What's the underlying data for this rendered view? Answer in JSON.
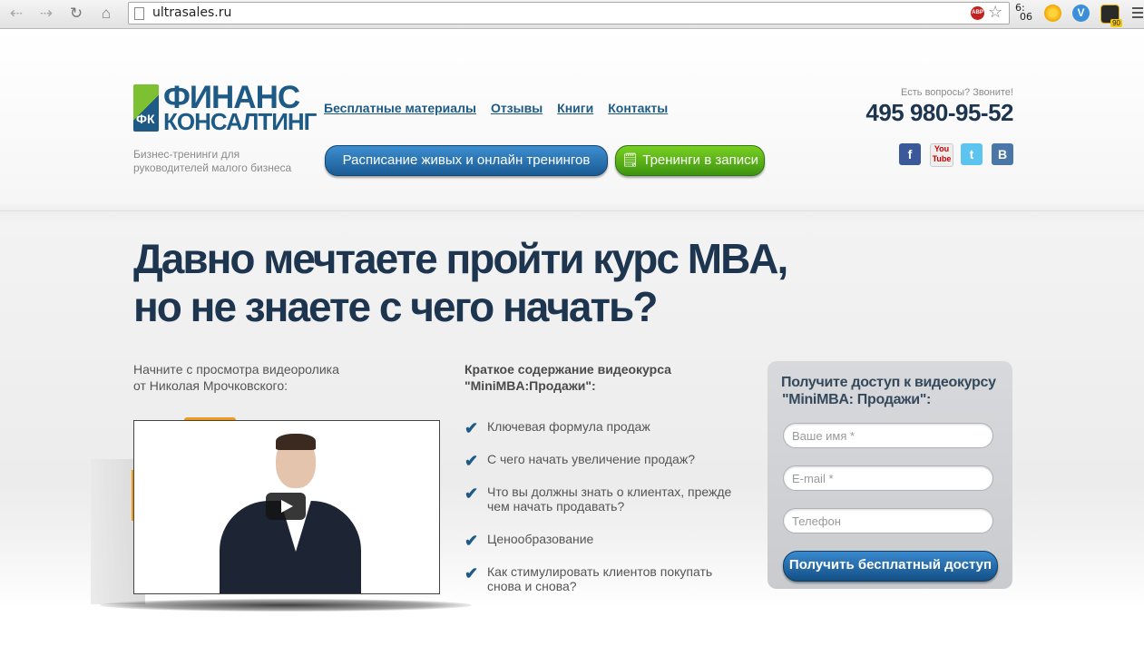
{
  "browser": {
    "url": "ultrasales.ru",
    "clock": [
      "6:",
      "06"
    ],
    "ext_badge": "90",
    "abp_label": "ABP"
  },
  "logo": {
    "line1": "ФИНАНС",
    "line2": "КОНСАЛТИНГ",
    "mark": "ФК"
  },
  "tagline": "Бизнес-тренинги для руководителей малого бизнеса",
  "nav": [
    "Бесплатные материалы",
    "Отзывы",
    "Книги",
    "Контакты"
  ],
  "buttons": {
    "schedule": "Расписание живых и онлайн тренингов",
    "recorded": "Тренинги в записи"
  },
  "contact": {
    "question": "Есть вопросы? Звоните!",
    "phone": "495 980-95-52"
  },
  "social": [
    "facebook",
    "youtube",
    "twitter",
    "vkontakte"
  ],
  "headline": [
    "Давно мечтаете пройти курс MBA,",
    "но не знаете с чего начать?"
  ],
  "intro": [
    "Начните с просмотра видеоролика",
    "от Николая Мрочковского:"
  ],
  "course": {
    "title": [
      "Краткое содержание видеокурса",
      "\"MiniMBA:Продажи\":"
    ],
    "items": [
      "Ключевая формула продаж",
      "С чего начать увеличение продаж?",
      "Что вы должны знать о клиентах, прежде чем начать продавать?",
      "Ценообразование",
      "Как стимулировать клиентов покупать снова и снова?"
    ]
  },
  "form": {
    "title": [
      "Получите доступ к видеокурсу",
      "\"MiniMBA: Продажи\":"
    ],
    "name_placeholder": "Ваше имя *",
    "email_placeholder": "E-mail *",
    "phone_placeholder": "Телефон",
    "submit": "Получить бесплатный доступ"
  },
  "colors": {
    "brand_blue": "#1d5a86",
    "brand_green": "#7dc032",
    "headline": "#1e3550"
  }
}
